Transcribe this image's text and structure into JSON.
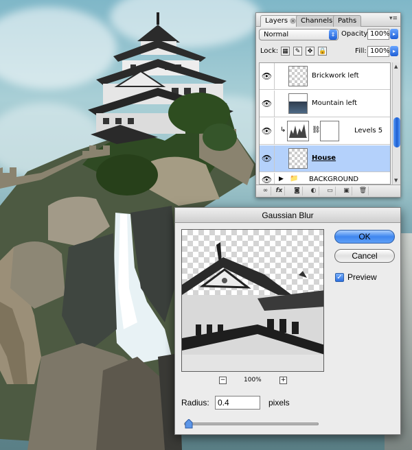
{
  "layers_panel": {
    "tabs": [
      {
        "label": "Layers",
        "active": true
      },
      {
        "label": "Channels",
        "active": false
      },
      {
        "label": "Paths",
        "active": false
      }
    ],
    "blend_mode": "Normal",
    "opacity_label": "Opacity:",
    "opacity_value": "100%",
    "lock_label": "Lock:",
    "fill_label": "Fill:",
    "fill_value": "100%",
    "layers": [
      {
        "name": "Brickwork left",
        "visible": true,
        "selected": false
      },
      {
        "name": "Mountain left",
        "visible": true,
        "selected": false
      },
      {
        "name": "Levels 5",
        "visible": true,
        "selected": false,
        "adjustment": true
      },
      {
        "name": "House",
        "visible": true,
        "selected": true
      },
      {
        "name": "BACKGROUND",
        "visible": true,
        "selected": false,
        "group": true
      }
    ],
    "bottom_icons": [
      "link-icon",
      "fx-icon",
      "mask-icon",
      "adjustment-icon",
      "folder-icon",
      "new-layer-icon",
      "trash-icon"
    ],
    "fx_text": "fx"
  },
  "gaussian_blur": {
    "title": "Gaussian Blur",
    "ok_label": "OK",
    "cancel_label": "Cancel",
    "preview_label": "Preview",
    "preview_checked": true,
    "zoom": "100%",
    "radius_label": "Radius:",
    "radius_value": "0.4",
    "radius_unit": "pixels"
  },
  "colors": {
    "selection": "#b4d1fb",
    "aqua_blue": "#3f86ef"
  }
}
